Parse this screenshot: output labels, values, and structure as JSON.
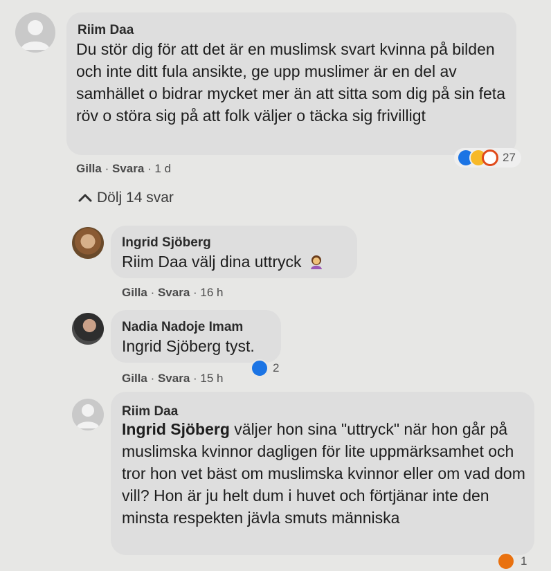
{
  "comments": [
    {
      "author": "Riim Daa",
      "text": "Du stör dig för att det är en muslimsk svart kvinna på bilden och inte ditt fula ansikte, ge upp muslimer är en del av samhället o bidrar mycket mer än att sitta som dig på sin feta röv o störa sig på att folk väljer o täcka sig frivilligt",
      "like_label": "Gilla",
      "reply_label": "Svara",
      "time": "1 d",
      "reaction_count": "27",
      "reaction_icons": [
        "like-icon",
        "haha-icon",
        "sad-icon"
      ]
    }
  ],
  "toggle": {
    "label": "Dölj 14 svar",
    "icon": "chevron-up-icon"
  },
  "replies": [
    {
      "author": "Ingrid Sjöberg",
      "mention": "Riim Daa",
      "text": " välj dina uttryck",
      "emoji": "woman-facepalming-icon",
      "like_label": "Gilla",
      "reply_label": "Svara",
      "time": "16 h"
    },
    {
      "author": "Nadia Nadoje Imam",
      "mention": "Ingrid Sjöberg",
      "text": " tyst.",
      "like_label": "Gilla",
      "reply_label": "Svara",
      "time": "15 h",
      "reaction_count": "2",
      "reaction_icons": [
        "like-icon"
      ]
    },
    {
      "author": "Riim Daa",
      "mention": "Ingrid Sjöberg",
      "text": " väljer hon sina \"uttryck\" när hon går på muslimska kvinnor dagligen för lite uppmärksamhet och tror hon vet bäst om muslimska kvinnor eller om vad dom vill? Hon är ju helt dum i huvet och förtjänar inte den minsta respekten jävla smuts människa",
      "reaction_count": "1",
      "reaction_icons": [
        "angry-icon"
      ]
    }
  ],
  "separator": " · "
}
